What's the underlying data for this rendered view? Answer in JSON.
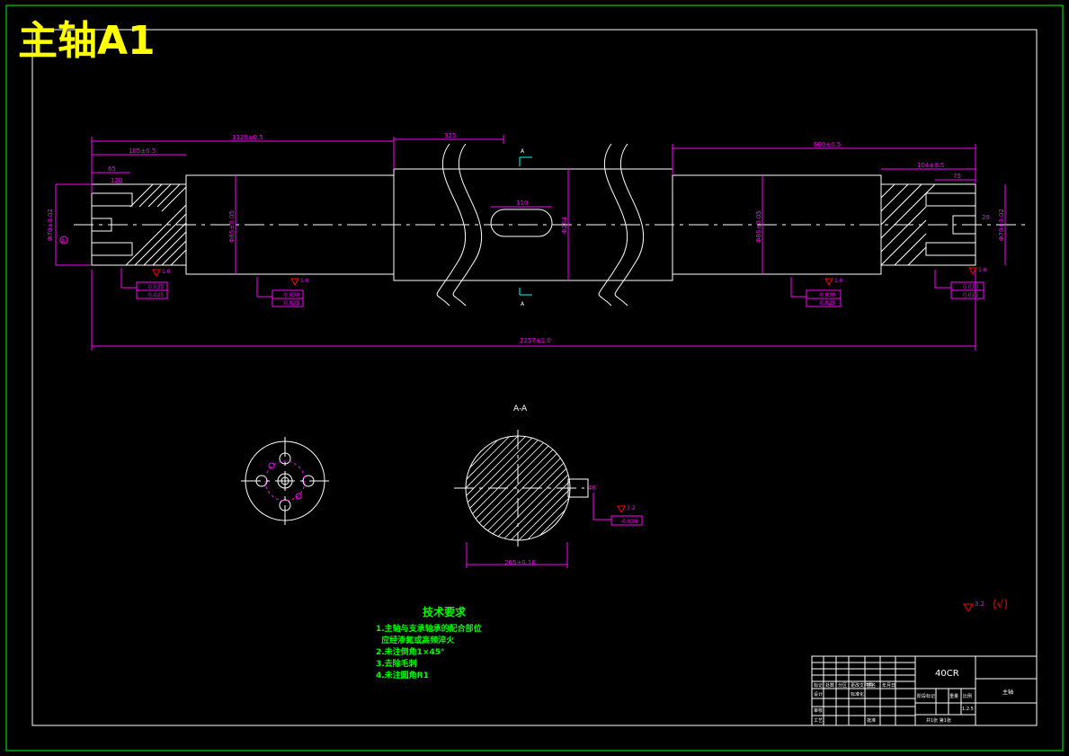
{
  "drawing": {
    "title": "主轴A1",
    "material": "40CR",
    "part_name": "主轴",
    "scale": "1:2.5"
  },
  "dimensions": {
    "overall_length": "2257±1.0",
    "left_bearing_section": "1320±0.5",
    "left_shoulder": "105±0.5",
    "left_bore_depth": "65",
    "left_small_dim": "120",
    "center_section": "325",
    "right_bearing_section": "600±0.5",
    "right_shoulder": "104±0.5",
    "right_bore_depth": "75",
    "keyway_length": "110",
    "left_diameter": "Φ70±0.02",
    "left_bearing_diameter": "Φ85±0.05",
    "body_diameter": "Φ264",
    "right_bearing_diameter": "Φ85±0.05",
    "right_end_diameter": "Φ70±0.02",
    "section_width": "265±0.16",
    "keyway_depth": "46",
    "right_bore_diameter": "28"
  },
  "roughness": {
    "ra_value": "3.2",
    "label_1": "1.6",
    "label_2": "1.6",
    "label_3": "1.6",
    "label_4": "1.6",
    "label_5": "3.2",
    "general": "(√)"
  },
  "tolerances": {
    "t1": "0.030",
    "t2": "0.025",
    "t3": "0.030",
    "t4": "0.025",
    "datum": "A"
  },
  "section_label": "A-A",
  "section_marker": "A",
  "tech_requirements": {
    "heading": "技术要求",
    "items": [
      "1.主轴与支承轴承的配合部位",
      "  应经渗氮或高频淬火",
      "2.未注倒角1×45°",
      "3.去除毛刺",
      "4.未注圆角R1"
    ]
  },
  "title_block": {
    "row_labels_1": [
      "标记",
      "处数",
      "分区",
      "更改文件号",
      "签名",
      "年月日"
    ],
    "row_labels_2": [
      "设计",
      "标准化"
    ],
    "row_labels_3": [
      "审核"
    ],
    "row_labels_4": [
      "工艺",
      "批准"
    ],
    "stage_labels": [
      "阶段标记",
      "重量",
      "比例"
    ],
    "sheet_label": "共1张  第1张"
  }
}
